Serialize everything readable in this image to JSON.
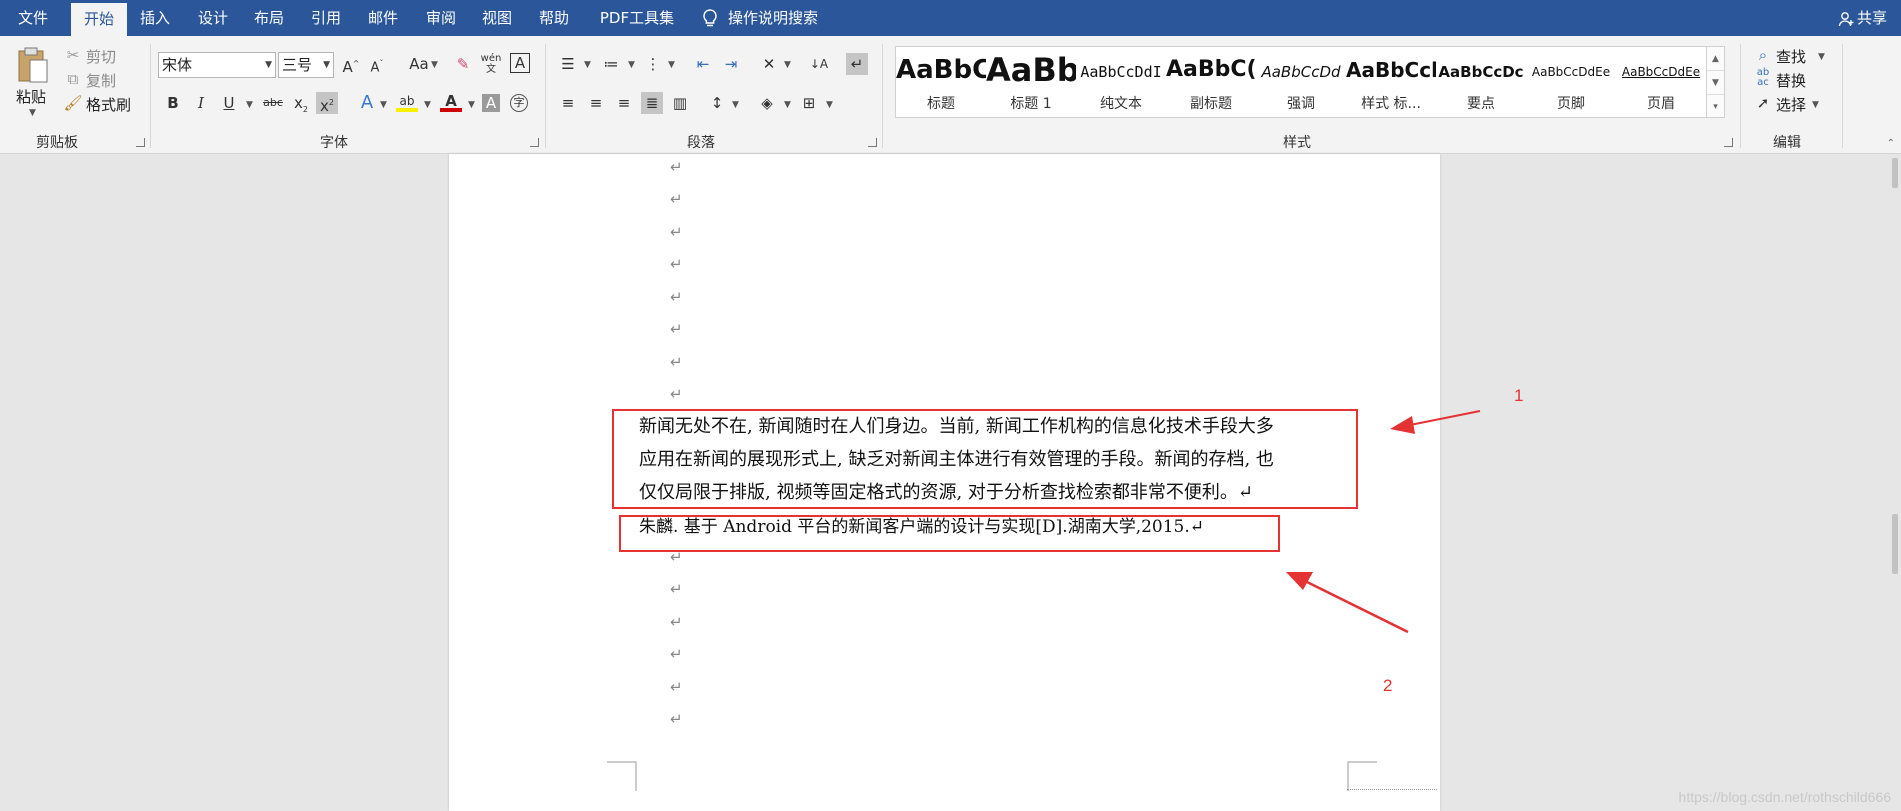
{
  "tabs": [
    {
      "label": "文件",
      "active": false
    },
    {
      "label": "开始",
      "active": true
    },
    {
      "label": "插入",
      "active": false
    },
    {
      "label": "设计",
      "active": false
    },
    {
      "label": "布局",
      "active": false
    },
    {
      "label": "引用",
      "active": false
    },
    {
      "label": "邮件",
      "active": false
    },
    {
      "label": "审阅",
      "active": false
    },
    {
      "label": "视图",
      "active": false
    },
    {
      "label": "帮助",
      "active": false
    },
    {
      "label": "PDF工具集",
      "active": false
    }
  ],
  "search_hint": "操作说明搜索",
  "share_label": "共享",
  "clipboard": {
    "paste": "粘贴",
    "cut": "剪切",
    "copy": "复制",
    "format_painter": "格式刷",
    "group_label": "剪贴板"
  },
  "font": {
    "family_value": "宋体",
    "size_value": "三号",
    "change_case": "Aa",
    "group_label": "字体"
  },
  "paragraph": {
    "group_label": "段落"
  },
  "styles": {
    "group_label": "样式",
    "items": [
      {
        "sample": "AaBbC(",
        "name": "标题"
      },
      {
        "sample": "AaBb",
        "name": "标题 1"
      },
      {
        "sample": "AaBbCcDdI",
        "name": "纯文本"
      },
      {
        "sample": "AaBbC(",
        "name": "副标题"
      },
      {
        "sample": "AaBbCcDd",
        "name": "强调"
      },
      {
        "sample": "AaBbCcl",
        "name": "样式 标..."
      },
      {
        "sample": "AaBbCcDc",
        "name": "要点"
      },
      {
        "sample": "AaBbCcDdEe",
        "name": "页脚"
      },
      {
        "sample": "AaBbCcDdEe",
        "name": "页眉"
      }
    ]
  },
  "editing": {
    "find": "查找",
    "replace": "替换",
    "select": "选择",
    "group_label": "编辑"
  },
  "document": {
    "paragraph_mark": "↵",
    "body_lines": [
      "新闻无处不在, 新闻随时在人们身边。当前, 新闻工作机构的信息化技术手段大多",
      "应用在新闻的展现形式上, 缺乏对新闻主体进行有效管理的手段。新闻的存档, 也",
      "仅仅局限于排版, 视频等固定格式的资源, 对于分析查找检索都非常不便利。↵"
    ],
    "reference_line": "朱麟. 基于 Android 平台的新闻客户端的设计与实现[D].湖南大学,2015.↵"
  },
  "annotations": {
    "label_1": "1",
    "label_2": "2",
    "color": "#e53333"
  },
  "watermark": "https://blog.csdn.net/rothschild666",
  "colors": {
    "titlebar": "#2b579a",
    "ribbon": "#f3f3f3",
    "canvas": "#e6e6e6"
  }
}
